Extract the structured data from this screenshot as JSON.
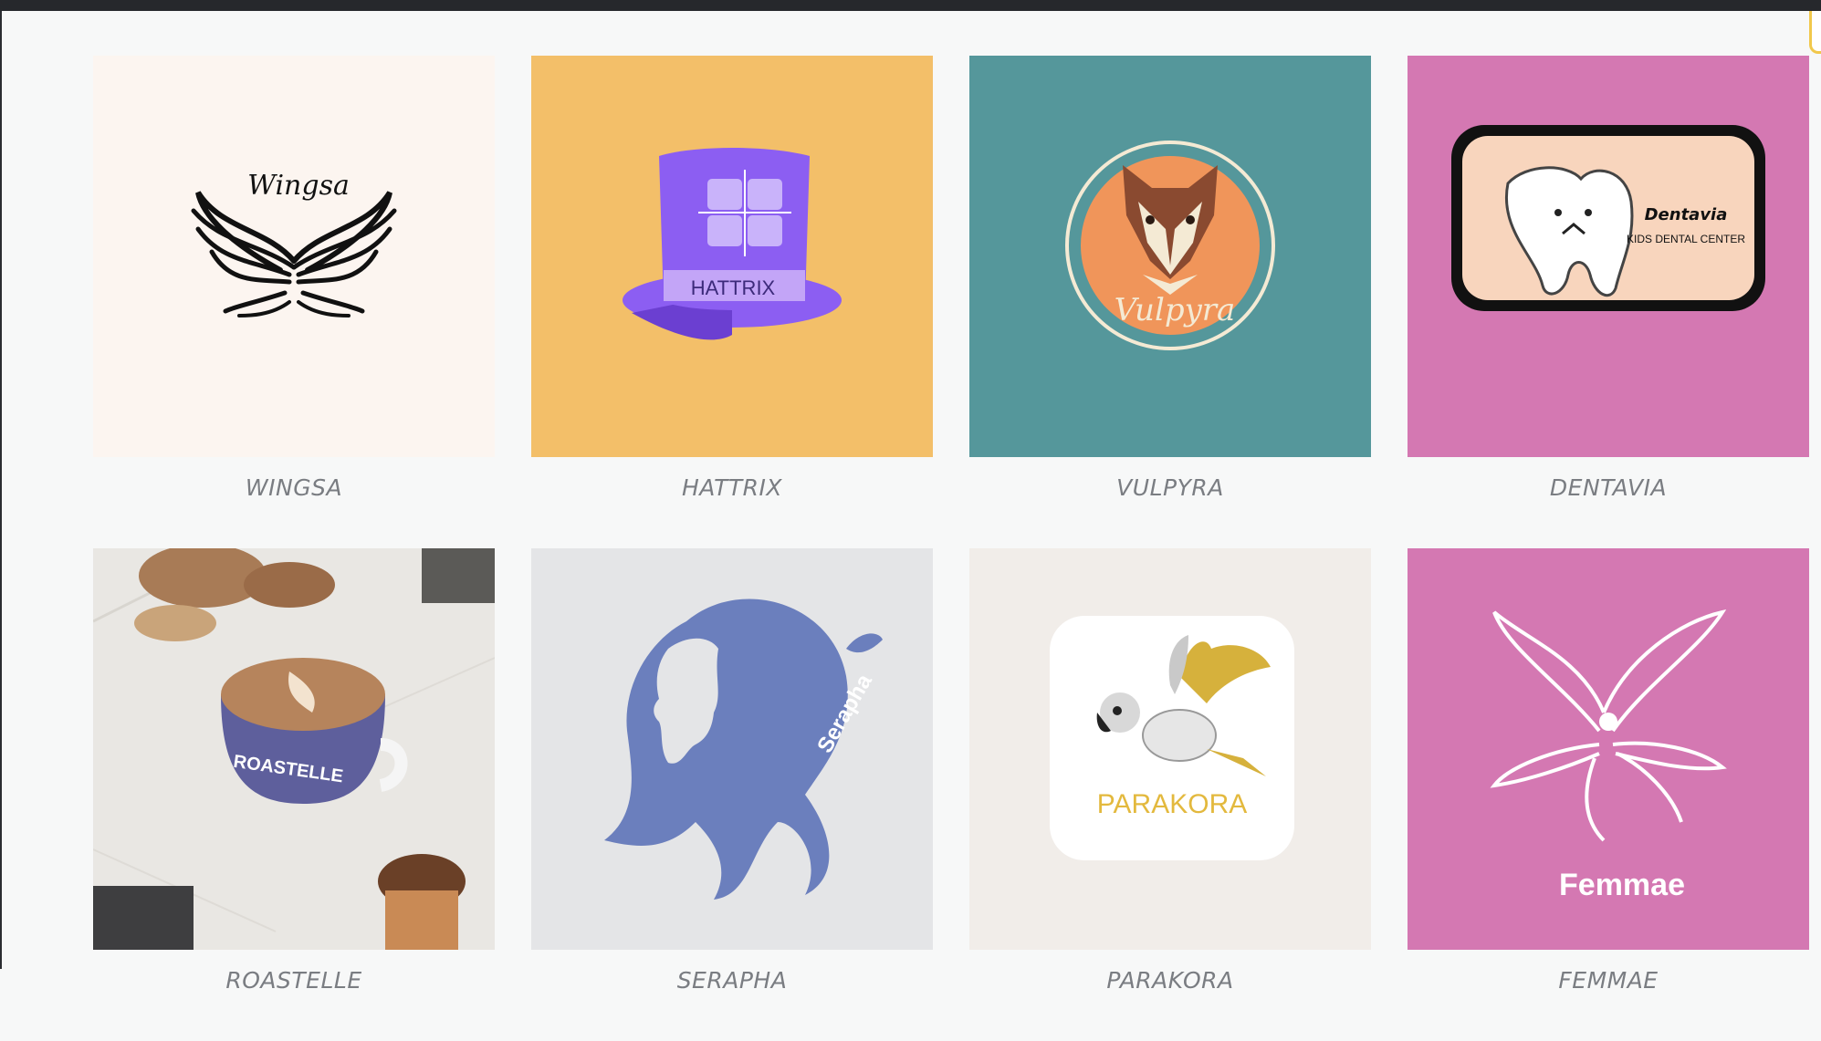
{
  "logos": [
    {
      "title": "WINGSA",
      "mark": "Wingsa",
      "bg": "#fcf5f0",
      "icon": "wings-logo"
    },
    {
      "title": "HATTRIX",
      "mark": "HATTRIX",
      "bg": "#f3bf69",
      "icon": "top-hat-logo"
    },
    {
      "title": "VULPYRA",
      "mark": "Vulpyra",
      "bg": "#55979b",
      "icon": "fox-logo"
    },
    {
      "title": "DENTAVIA",
      "mark": "Dentavia",
      "sub": "KIDS DENTAL CENTER",
      "bg": "#d478b2",
      "icon": "tooth-logo"
    },
    {
      "title": "ROASTELLE",
      "mark": "ROASTELLE",
      "bg": "#e9e7e3",
      "icon": "coffee-cup-logo"
    },
    {
      "title": "SERAPHA",
      "mark": "Serapha",
      "bg": "#e4e5e7",
      "icon": "woman-profile-logo"
    },
    {
      "title": "PARAKORA",
      "mark": "PARAKORA",
      "bg": "#f1ede9",
      "icon": "parrot-logo"
    },
    {
      "title": "FEMMAE",
      "mark": "Femmae",
      "bg": "#d478b2",
      "icon": "fairy-logo"
    }
  ],
  "colors": {
    "topbar": "#26282c",
    "caption": "#7a7d82",
    "hat_purple": "#8c5ef2",
    "fox_orange": "#f0955a",
    "serapha_blue": "#6b7fbd"
  }
}
